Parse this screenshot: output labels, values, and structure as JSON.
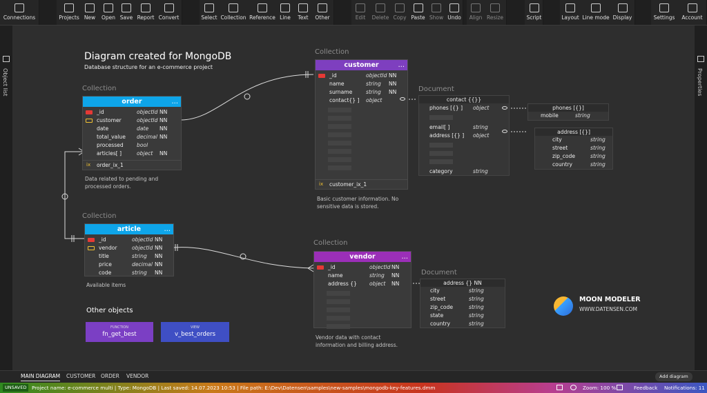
{
  "toolbar": {
    "connections": "Connections",
    "projects": "Projects",
    "new": "New",
    "open": "Open",
    "save": "Save",
    "report": "Report",
    "convert": "Convert",
    "select": "Select",
    "collection": "Collection",
    "reference": "Reference",
    "line": "Line",
    "text": "Text",
    "other": "Other",
    "edit": "Edit",
    "delete": "Delete",
    "copy": "Copy",
    "paste": "Paste",
    "show": "Show",
    "undo": "Undo",
    "align": "Align",
    "resize": "Resize",
    "script": "Script",
    "layout": "Layout",
    "line_mode": "Line mode",
    "display": "Display",
    "settings": "Settings",
    "account": "Account"
  },
  "sidebars": {
    "left": "Object list",
    "right": "Properties"
  },
  "diagram": {
    "title": "Diagram created for MongoDB",
    "subtitle": "Database structure for an e-commerce project",
    "collection_label": "Collection",
    "document_label": "Document"
  },
  "order": {
    "name": "order",
    "color": "#0ea5e9",
    "rows": [
      [
        "_id",
        "objectId",
        "NN"
      ],
      [
        "customer",
        "objectId",
        "NN"
      ],
      [
        "date",
        "date",
        "NN"
      ],
      [
        "total_value",
        "decimal",
        "NN"
      ],
      [
        "processed",
        "bool",
        ""
      ],
      [
        "articles[ ]",
        "object",
        "NN"
      ]
    ],
    "index": "order_ix_1",
    "note": "Data related to pending and processed orders."
  },
  "customer": {
    "name": "customer",
    "color": "#7e3fbf",
    "rows": [
      [
        "_id",
        "objectId",
        "NN"
      ],
      [
        "name",
        "string",
        "NN"
      ],
      [
        "surname",
        "string",
        "NN"
      ],
      [
        "contact{} ]",
        "object",
        ""
      ]
    ],
    "index": "customer_ix_1",
    "note": "Basic customer information. No sensitive data is stored."
  },
  "article": {
    "name": "article",
    "color": "#0ea5e9",
    "rows": [
      [
        "_id",
        "objectId",
        "NN"
      ],
      [
        "vendor",
        "objectId",
        "NN"
      ],
      [
        "title",
        "string",
        "NN"
      ],
      [
        "price",
        "decimal",
        "NN"
      ],
      [
        "code",
        "string",
        "NN"
      ]
    ],
    "note": "Available items"
  },
  "vendor": {
    "name": "vendor",
    "color": "#9b2fb8",
    "rows": [
      [
        "_id",
        "objectId",
        "NN"
      ],
      [
        "name",
        "string",
        "NN"
      ],
      [
        "address {}",
        "object",
        "NN"
      ]
    ],
    "note": "Vendor data with contact information and billing address."
  },
  "contact": {
    "title": "contact {{}}",
    "rows": [
      [
        "phones [{} ]",
        "object"
      ],
      [
        "email[ ]",
        "string"
      ],
      [
        "address [{} ]",
        "object"
      ],
      [
        "category",
        "string"
      ]
    ]
  },
  "phones": {
    "title": "phones [{}]",
    "rows": [
      [
        "mobile",
        "string"
      ]
    ]
  },
  "cust_address": {
    "title": "address [{}]",
    "rows": [
      [
        "city",
        "string"
      ],
      [
        "street",
        "string"
      ],
      [
        "zip_code",
        "string"
      ],
      [
        "country",
        "string"
      ]
    ]
  },
  "vendor_address": {
    "title": "address {} NN",
    "rows": [
      [
        "city",
        "string"
      ],
      [
        "street",
        "string"
      ],
      [
        "zip_code",
        "string"
      ],
      [
        "state",
        "string"
      ],
      [
        "country",
        "string"
      ]
    ]
  },
  "other": {
    "title": "Other objects",
    "function_type": "FUNCTION",
    "function_name": "fn_get_best",
    "view_type": "VIEW",
    "view_name": "v_best_orders"
  },
  "brand": {
    "name": "MOON MODELER",
    "url": "WWW.DATENSEN.COM"
  },
  "tabs": [
    "MAIN DIAGRAM",
    "CUSTOMER",
    "ORDER",
    "VENDOR"
  ],
  "add_diagram": "Add diagram",
  "status": {
    "unsaved": "UNSAVED",
    "info": "Project name: e-commerce multi | Type: MongoDB | Last saved: 14.07.2023 10:53 | File path: E:\\Dev\\Datensen\\samples\\new-samples\\mongodb-key-features.dmm",
    "zoom": "Zoom: 100 %",
    "feedback": "Feedback",
    "notifications": "Notifications: 11"
  },
  "colors": {
    "function": "#7b3fc4",
    "view": "#3f4fc4",
    "key_pk": "#e53935",
    "key_fk": "#f1c232"
  }
}
